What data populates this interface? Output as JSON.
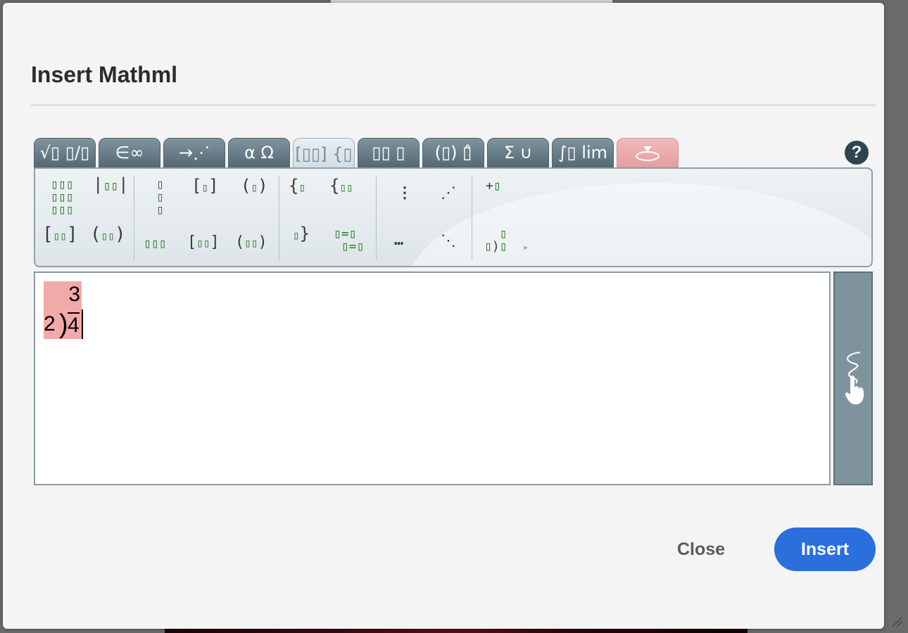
{
  "dialog": {
    "title": "Insert Mathml",
    "help_label": "?",
    "close_label": "Close",
    "insert_label": "Insert"
  },
  "tabs": [
    {
      "label": "√▯ ▯/▯",
      "name": "tab-radicals-fractions"
    },
    {
      "label": "∈∞",
      "name": "tab-symbols"
    },
    {
      "label": "→⋰",
      "name": "tab-arrows"
    },
    {
      "label": "α Ω",
      "name": "tab-greek"
    },
    {
      "label": "[▯▯] {▯",
      "name": "tab-matrices",
      "active": true
    },
    {
      "label": "▯▯ ▯",
      "name": "tab-scripts"
    },
    {
      "label": "(▯) ▯̂",
      "name": "tab-fences-accents"
    },
    {
      "label": "Σ ∪",
      "name": "tab-operators"
    },
    {
      "label": "∫▯ lim",
      "name": "tab-calculus"
    },
    {
      "label": "",
      "name": "tab-handwriting",
      "hand": true
    }
  ],
  "editor": {
    "quotient": "3",
    "divisor": "2",
    "dividend": "4"
  }
}
